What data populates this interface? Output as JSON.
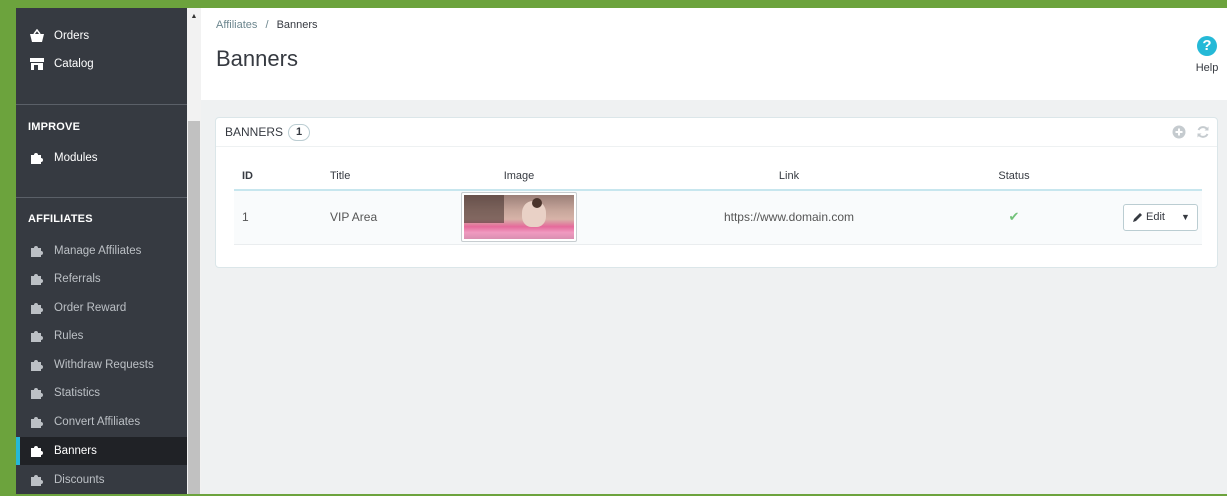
{
  "sidebar": {
    "top_items": [
      {
        "label": "Orders",
        "icon": "basket-icon"
      },
      {
        "label": "Catalog",
        "icon": "store-icon"
      }
    ],
    "sections": [
      {
        "heading": "IMPROVE",
        "items": [
          {
            "label": "Modules",
            "icon": "puzzle-icon"
          }
        ]
      },
      {
        "heading": "AFFILIATES",
        "items": [
          {
            "label": "Manage Affiliates",
            "icon": "puzzle-icon"
          },
          {
            "label": "Referrals",
            "icon": "puzzle-icon"
          },
          {
            "label": "Order Reward",
            "icon": "puzzle-icon"
          },
          {
            "label": "Rules",
            "icon": "puzzle-icon"
          },
          {
            "label": "Withdraw Requests",
            "icon": "puzzle-icon"
          },
          {
            "label": "Statistics",
            "icon": "puzzle-icon"
          },
          {
            "label": "Convert Affiliates",
            "icon": "puzzle-icon"
          },
          {
            "label": "Banners",
            "icon": "puzzle-icon",
            "active": true
          },
          {
            "label": "Discounts",
            "icon": "puzzle-icon"
          }
        ]
      }
    ]
  },
  "header": {
    "breadcrumb": {
      "parent": "Affiliates",
      "separator": "/",
      "current": "Banners"
    },
    "title": "Banners",
    "help_label": "Help",
    "help_glyph": "?"
  },
  "panel": {
    "title": "BANNERS",
    "count": "1",
    "columns": [
      "ID",
      "Title",
      "Image",
      "Link",
      "Status"
    ],
    "rows": [
      {
        "id": "1",
        "title": "VIP Area",
        "image": "banner thumbnail",
        "link": "https://www.domain.com",
        "status": "enabled",
        "status_glyph": "✔",
        "edit_label": "Edit"
      }
    ]
  },
  "colors": {
    "accent": "#25b9d7",
    "frame_green": "#6ca33d",
    "sidebar_bg": "#363a41",
    "status_ok": "#72c279"
  }
}
